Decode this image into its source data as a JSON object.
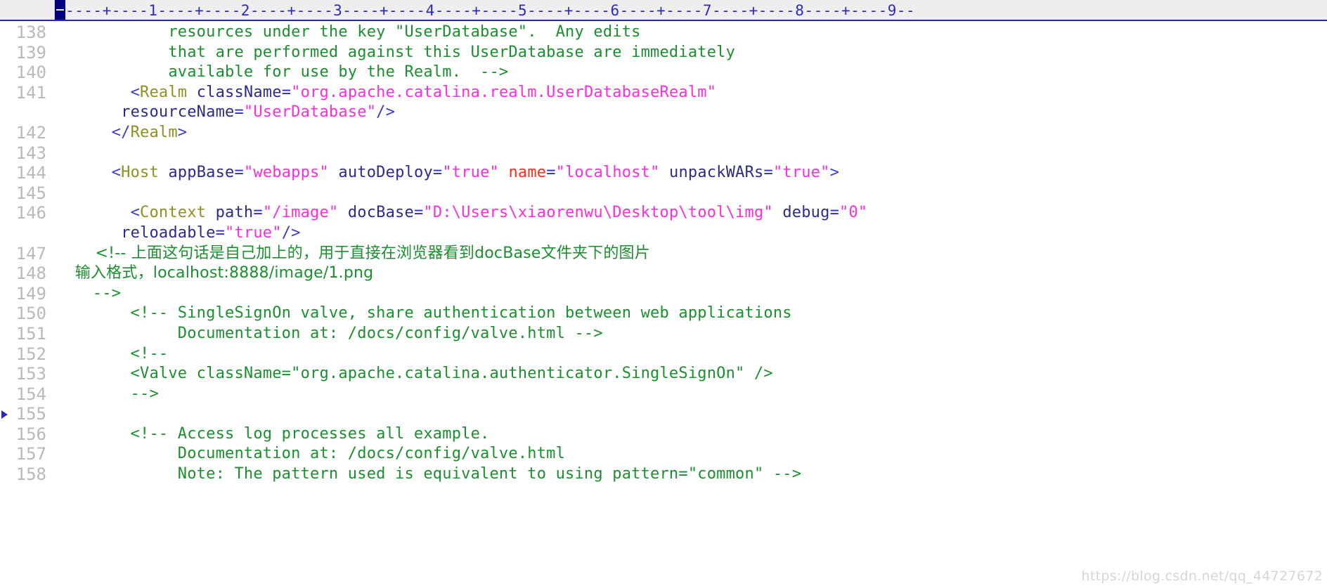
{
  "editor": {
    "ruler": {
      "scale_text": "----+----1----+----2----+----3----+----4----+----5----+----6----+----7----+----8----+----9--",
      "cursor_marker": "",
      "color": "#2b2bbb"
    },
    "colors": {
      "comment": "#1a8f2e",
      "bracket": "#3a3ad0",
      "tag": "#8f8f22",
      "attribute": "#2b2b8f",
      "attribute_highlight": "#ff2b1a",
      "value": "#ff2bdd",
      "line_number": "#b9b9bd",
      "background": "#ffffff",
      "ruler_background": "#efeeee",
      "cursor_block": "#000080"
    },
    "current_line_marker": "155",
    "watermark": "https://blog.csdn.net/qq_44727672",
    "gutter_numbers": [
      "138",
      "139",
      "140",
      "141",
      "",
      "142",
      "143",
      "144",
      "145",
      "146",
      "",
      "147",
      "148",
      "149",
      "150",
      "151",
      "152",
      "153",
      "154",
      "155",
      "",
      "156",
      "157",
      "158"
    ],
    "lines": [
      {
        "number": "138",
        "tokens": [
          {
            "cls": "t-comment",
            "text": "            resources under the key \"UserDatabase\".  Any edits"
          }
        ]
      },
      {
        "number": "139",
        "tokens": [
          {
            "cls": "t-comment",
            "text": "            that are performed against this UserDatabase are immediately"
          }
        ]
      },
      {
        "number": "140",
        "tokens": [
          {
            "cls": "t-comment",
            "text": "            available for use by the Realm.  -->"
          }
        ]
      },
      {
        "number": "141",
        "tokens": [
          {
            "cls": "plain",
            "text": "        "
          },
          {
            "cls": "t-bracket",
            "text": "<"
          },
          {
            "cls": "t-tag",
            "text": "Realm "
          },
          {
            "cls": "t-attr",
            "text": "className"
          },
          {
            "cls": "t-eq",
            "text": "="
          },
          {
            "cls": "t-value",
            "text": "\"org.apache.catalina.realm.UserDatabaseRealm\""
          }
        ]
      },
      {
        "number": "",
        "tokens": [
          {
            "cls": "plain",
            "text": "       "
          },
          {
            "cls": "t-attr",
            "text": "resourceName"
          },
          {
            "cls": "t-eq",
            "text": "="
          },
          {
            "cls": "t-value",
            "text": "\"UserDatabase\""
          },
          {
            "cls": "t-bracket",
            "text": "/>"
          }
        ]
      },
      {
        "number": "142",
        "tokens": [
          {
            "cls": "plain",
            "text": "      "
          },
          {
            "cls": "t-bracket",
            "text": "</"
          },
          {
            "cls": "t-tag",
            "text": "Realm"
          },
          {
            "cls": "t-bracket",
            "text": ">"
          }
        ]
      },
      {
        "number": "143",
        "tokens": [
          {
            "cls": "plain",
            "text": ""
          }
        ]
      },
      {
        "number": "144",
        "tokens": [
          {
            "cls": "plain",
            "text": "      "
          },
          {
            "cls": "t-bracket",
            "text": "<"
          },
          {
            "cls": "t-tag",
            "text": "Host "
          },
          {
            "cls": "t-attr",
            "text": "appBase"
          },
          {
            "cls": "t-eq",
            "text": "="
          },
          {
            "cls": "t-value",
            "text": "\"webapps\""
          },
          {
            "cls": "plain",
            "text": " "
          },
          {
            "cls": "t-attr",
            "text": "autoDeploy"
          },
          {
            "cls": "t-eq",
            "text": "="
          },
          {
            "cls": "t-value",
            "text": "\"true\""
          },
          {
            "cls": "plain",
            "text": " "
          },
          {
            "cls": "t-attr-hl",
            "text": "name"
          },
          {
            "cls": "t-eq",
            "text": "="
          },
          {
            "cls": "t-value",
            "text": "\"localhost\""
          },
          {
            "cls": "plain",
            "text": " "
          },
          {
            "cls": "t-attr",
            "text": "unpackWARs"
          },
          {
            "cls": "t-eq",
            "text": "="
          },
          {
            "cls": "t-value",
            "text": "\"true\""
          },
          {
            "cls": "t-bracket",
            "text": ">"
          }
        ]
      },
      {
        "number": "145",
        "tokens": [
          {
            "cls": "plain",
            "text": ""
          }
        ]
      },
      {
        "number": "146",
        "tokens": [
          {
            "cls": "plain",
            "text": "        "
          },
          {
            "cls": "t-bracket",
            "text": "<"
          },
          {
            "cls": "t-tag",
            "text": "Context "
          },
          {
            "cls": "t-attr",
            "text": "path"
          },
          {
            "cls": "t-eq",
            "text": "="
          },
          {
            "cls": "t-value",
            "text": "\"/image\""
          },
          {
            "cls": "plain",
            "text": " "
          },
          {
            "cls": "t-attr",
            "text": "docBase"
          },
          {
            "cls": "t-eq",
            "text": "="
          },
          {
            "cls": "t-value",
            "text": "\"D:\\Users\\xiaorenwu\\Desktop\\tool\\img\""
          },
          {
            "cls": "plain",
            "text": " "
          },
          {
            "cls": "t-attr",
            "text": "debug"
          },
          {
            "cls": "t-eq",
            "text": "="
          },
          {
            "cls": "t-value",
            "text": "\"0\""
          }
        ]
      },
      {
        "number": "",
        "tokens": [
          {
            "cls": "plain",
            "text": "       "
          },
          {
            "cls": "t-attr",
            "text": "reloadable"
          },
          {
            "cls": "t-eq",
            "text": "="
          },
          {
            "cls": "t-value",
            "text": "\"true\""
          },
          {
            "cls": "t-bracket",
            "text": "/>"
          }
        ]
      },
      {
        "number": "147",
        "cjk": true,
        "tokens": [
          {
            "cls": "t-comment",
            "text": "        <!-- 上面这句话是自己加上的，用于直接在浏览器看到docBase文件夹下的图片"
          }
        ]
      },
      {
        "number": "148",
        "cjk": true,
        "tokens": [
          {
            "cls": "t-comment",
            "text": "    输入格式，localhost:8888/image/1.png"
          }
        ]
      },
      {
        "number": "149",
        "tokens": [
          {
            "cls": "t-comment",
            "text": "    -->"
          }
        ]
      },
      {
        "number": "150",
        "tokens": [
          {
            "cls": "t-comment",
            "text": "        <!-- SingleSignOn valve, share authentication between web applications"
          }
        ]
      },
      {
        "number": "151",
        "tokens": [
          {
            "cls": "t-comment",
            "text": "             Documentation at: /docs/config/valve.html -->"
          }
        ]
      },
      {
        "number": "152",
        "tokens": [
          {
            "cls": "t-comment",
            "text": "        <!--"
          }
        ]
      },
      {
        "number": "153",
        "tokens": [
          {
            "cls": "t-comment",
            "text": "        <Valve className=\"org.apache.catalina.authenticator.SingleSignOn\" />"
          }
        ]
      },
      {
        "number": "154",
        "tokens": [
          {
            "cls": "t-comment",
            "text": "        -->"
          }
        ]
      },
      {
        "number": "155",
        "marker": true,
        "tokens": [
          {
            "cls": "plain",
            "text": ""
          }
        ]
      },
      {
        "number": "156",
        "tokens": [
          {
            "cls": "t-comment",
            "text": "        <!-- Access log processes all example."
          }
        ]
      },
      {
        "number": "157",
        "tokens": [
          {
            "cls": "t-comment",
            "text": "             Documentation at: /docs/config/valve.html"
          }
        ]
      },
      {
        "number": "158",
        "tokens": [
          {
            "cls": "t-comment",
            "text": "             Note: The pattern used is equivalent to using pattern=\"common\" -->"
          }
        ]
      }
    ]
  }
}
